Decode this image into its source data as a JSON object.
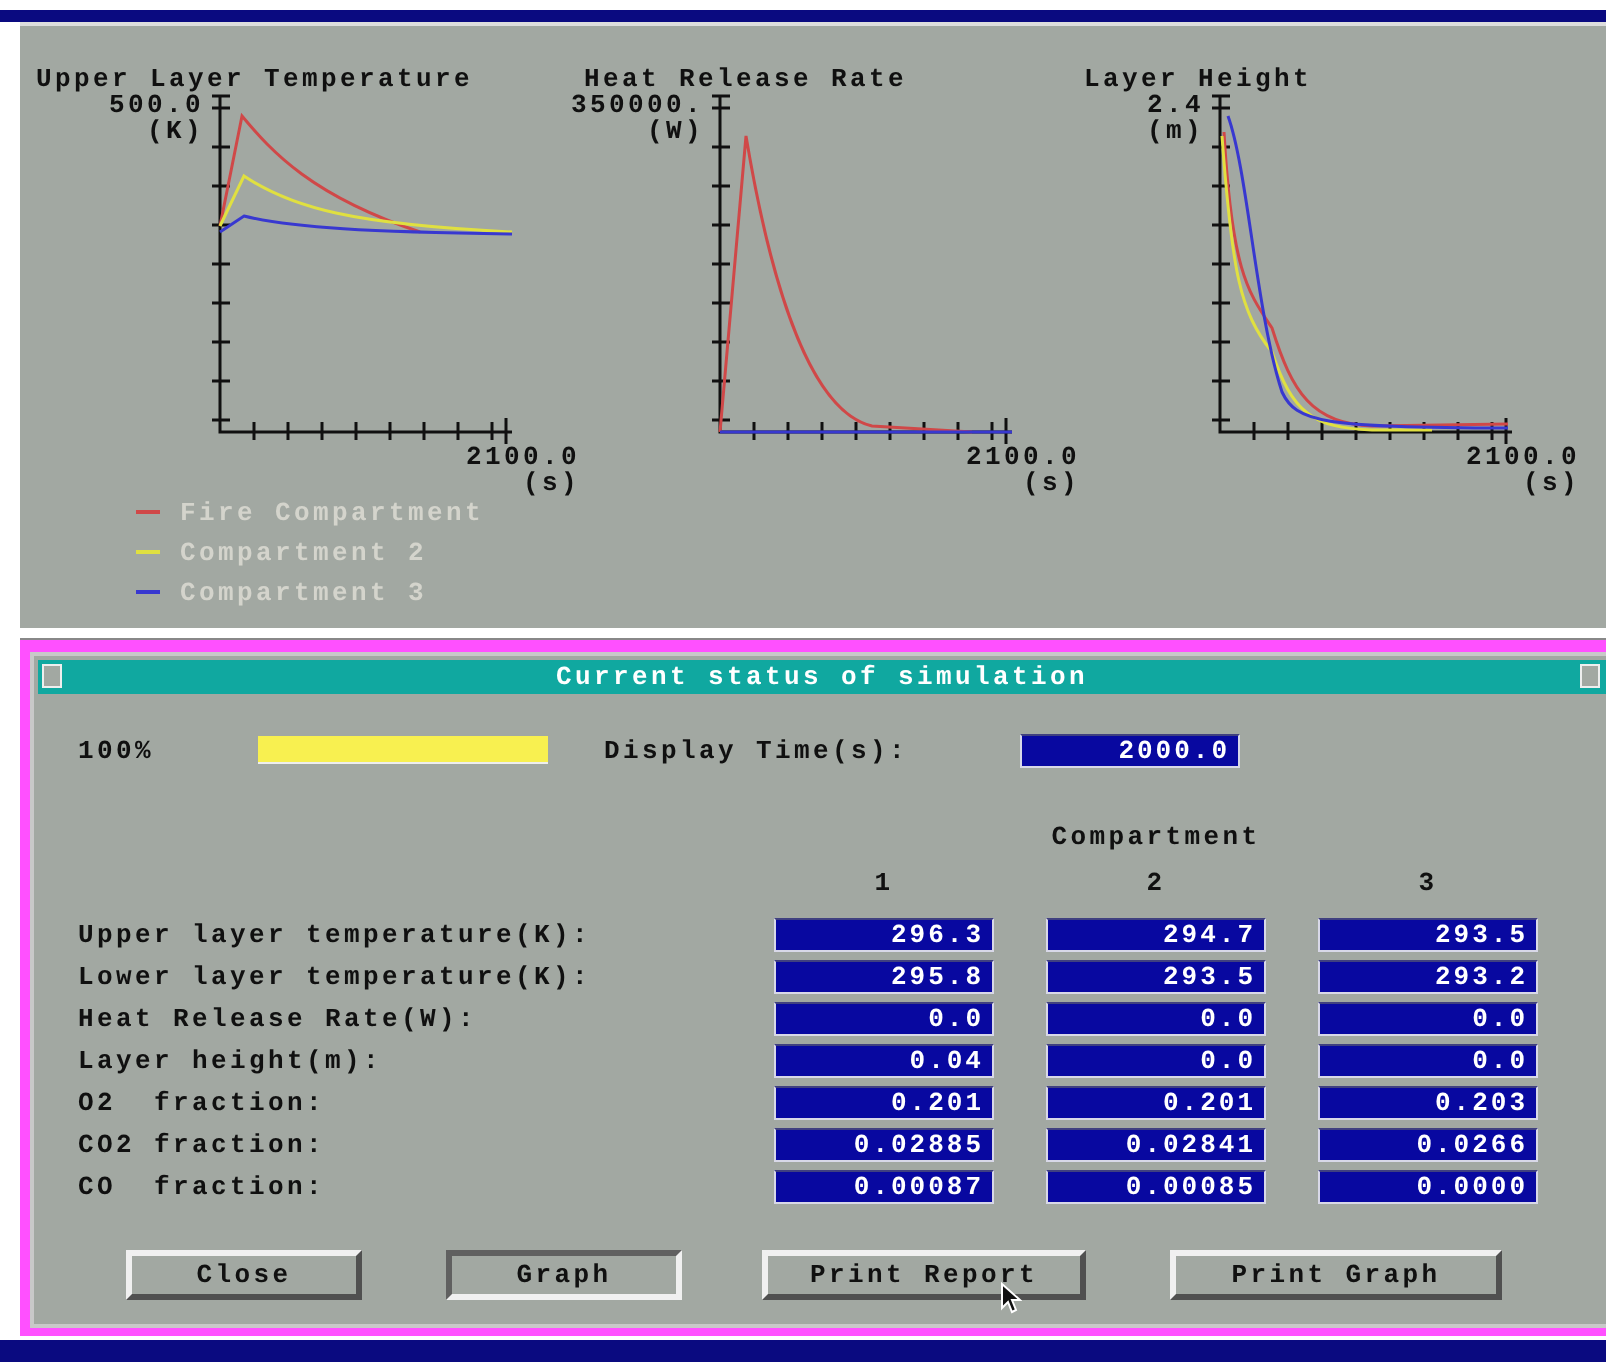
{
  "charts": [
    {
      "title": "Upper Layer Temperature",
      "y_max": "500.0",
      "y_unit": "(K)",
      "x_max": "2100.0",
      "x_unit": "(s)"
    },
    {
      "title": "Heat Release Rate",
      "y_max": "350000.",
      "y_unit": "(W)",
      "x_max": "2100.0",
      "x_unit": "(s)"
    },
    {
      "title": "Layer Height",
      "y_max": "2.4",
      "y_unit": "(m)",
      "x_max": "2100.0",
      "x_unit": "(s)"
    }
  ],
  "legend": [
    {
      "label": "Fire Compartment",
      "color": "#d04848"
    },
    {
      "label": "Compartment 2",
      "color": "#e0e040"
    },
    {
      "label": "Compartment 3",
      "color": "#3838d0"
    }
  ],
  "dialog": {
    "title": "Current status of simulation",
    "progress": {
      "label": "100%",
      "level": 1
    },
    "display_time": {
      "label": "Display Time(s):",
      "value": "2000.0"
    },
    "group_header": "Compartment",
    "columns": [
      "1",
      "2",
      "3"
    ],
    "rows": [
      {
        "label": "Upper layer temperature(K):",
        "values": [
          "296.3",
          "294.7",
          "293.5"
        ]
      },
      {
        "label": "Lower layer temperature(K):",
        "values": [
          "295.8",
          "293.5",
          "293.2"
        ]
      },
      {
        "label": "Heat Release Rate(W):",
        "values": [
          "0.0",
          "0.0",
          "0.0"
        ]
      },
      {
        "label": "Layer height(m):",
        "values": [
          "0.04",
          "0.0",
          "0.0"
        ]
      },
      {
        "label": "O2  fraction:",
        "values": [
          "0.201",
          "0.201",
          "0.203"
        ]
      },
      {
        "label": "CO2 fraction:",
        "values": [
          "0.02885",
          "0.02841",
          "0.0266"
        ]
      },
      {
        "label": "CO  fraction:",
        "values": [
          "0.00087",
          "0.00085",
          "0.0000"
        ]
      }
    ],
    "buttons": [
      {
        "label": "Close",
        "pressed": false
      },
      {
        "label": "Graph",
        "pressed": true
      },
      {
        "label": "Print Report",
        "pressed": false
      },
      {
        "label": "Print Graph",
        "pressed": false
      }
    ]
  }
}
